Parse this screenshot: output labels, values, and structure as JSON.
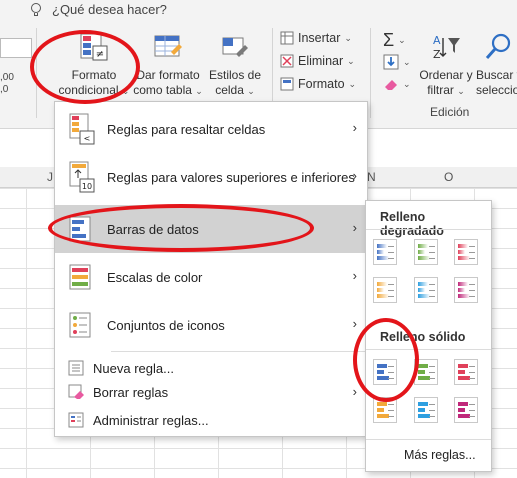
{
  "tell_me": {
    "placeholder": "¿Qué desea hacer?"
  },
  "ribbon": {
    "number_format_labels": [
      ",00",
      ",0"
    ],
    "formato_condicional": {
      "line1": "Formato",
      "line2": "condicional"
    },
    "dar_formato": {
      "line1": "Dar formato",
      "line2": "como tabla"
    },
    "estilos": {
      "line1": "Estilos de",
      "line2": "celda"
    },
    "insertar": "Insertar",
    "eliminar": "Eliminar",
    "formato": "Formato",
    "ordenar": {
      "line1": "Ordenar y",
      "line2": "filtrar"
    },
    "buscar": {
      "line1": "Buscar y",
      "line2": "selecciona"
    },
    "group_edicion": "Edición"
  },
  "columns": [
    "J",
    "N",
    "O"
  ],
  "menu": {
    "items": [
      {
        "label": "Reglas para resaltar celdas"
      },
      {
        "label": "Reglas para valores superiores e inferiores"
      },
      {
        "label": "Barras de datos"
      },
      {
        "label": "Escalas de color"
      },
      {
        "label": "Conjuntos de iconos"
      }
    ],
    "small_items": [
      {
        "label": "Nueva regla..."
      },
      {
        "label": "Borrar reglas"
      },
      {
        "label": "Administrar reglas..."
      }
    ]
  },
  "submenu": {
    "gradient_title": "Relleno degradado",
    "solid_title": "Relleno sólido",
    "more_rules": "Más reglas...",
    "colors": [
      "#4472c4",
      "#70ad47",
      "#e0405a",
      "#f2a93b",
      "#2e9fe0",
      "#c0287a"
    ]
  }
}
